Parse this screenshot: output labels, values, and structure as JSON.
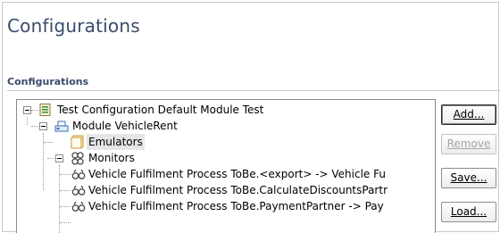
{
  "header": {
    "title": "Configurations"
  },
  "section": {
    "title": "Configurations"
  },
  "tree": {
    "items": [
      {
        "label": "Test Configuration Default Module Test",
        "icon": "test-configuration-icon"
      },
      {
        "label": "Module VehicleRent",
        "icon": "module-icon"
      },
      {
        "label": "Emulators",
        "icon": "emulators-icon"
      },
      {
        "label": "Monitors",
        "icon": "monitors-icon"
      },
      {
        "label": "Vehicle Fulfilment Process ToBe.<export> -> Vehicle Fu",
        "icon": "monitor-icon"
      },
      {
        "label": "Vehicle Fulfilment Process ToBe.CalculateDiscountsPartr",
        "icon": "monitor-icon"
      },
      {
        "label": "Vehicle Fulfilment Process ToBe.PaymentPartner -> Pay",
        "icon": "monitor-icon"
      }
    ]
  },
  "buttons": {
    "add": "Add...",
    "remove": "Remove",
    "save": "Save...",
    "load": "Load..."
  }
}
